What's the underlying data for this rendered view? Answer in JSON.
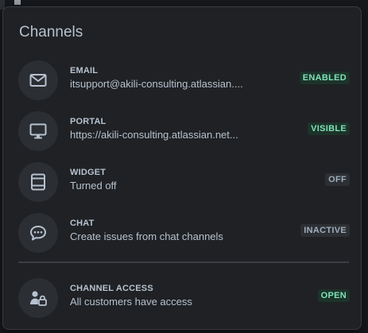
{
  "panel": {
    "title": "Channels"
  },
  "channels": [
    {
      "icon": "envelope-icon",
      "label": "EMAIL",
      "description": "itsupport@akili-consulting.atlassian....",
      "status": "ENABLED",
      "status_color": "#7ee2b8"
    },
    {
      "icon": "monitor-icon",
      "label": "PORTAL",
      "description": "https://akili-consulting.atlassian.net...",
      "status": "VISIBLE",
      "status_color": "#7ee2b8"
    },
    {
      "icon": "widget-icon",
      "label": "WIDGET",
      "description": "Turned off",
      "status": "OFF",
      "status_color": "#9fadbc"
    },
    {
      "icon": "chat-bubble-icon",
      "label": "CHAT",
      "description": "Create issues from chat channels",
      "status": "INACTIVE",
      "status_color": "#9fadbc"
    }
  ],
  "channel_access": {
    "icon": "person-lock-icon",
    "label": "CHANNEL ACCESS",
    "description": "All customers have access",
    "status": "OPEN",
    "status_color": "#7ee2b8"
  }
}
